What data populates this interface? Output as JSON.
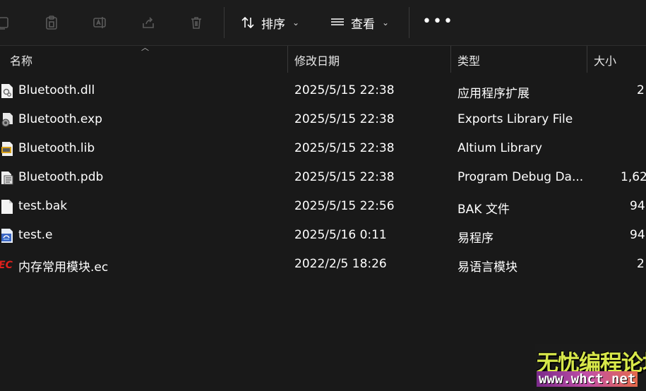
{
  "toolbar": {
    "sort_label": "排序",
    "view_label": "查看",
    "more_label": "•••"
  },
  "columns": {
    "name": "名称",
    "date": "修改日期",
    "type": "类型",
    "size": "大小"
  },
  "files": [
    {
      "name": "Bluetooth.dll",
      "date": "2025/5/15 22:38",
      "type": "应用程序扩展",
      "size": "2",
      "icon": "dll-file-icon"
    },
    {
      "name": "Bluetooth.exp",
      "date": "2025/5/15 22:38",
      "type": "Exports Library File",
      "size": "",
      "icon": "exp-file-icon"
    },
    {
      "name": "Bluetooth.lib",
      "date": "2025/5/15 22:38",
      "type": "Altium Library",
      "size": "",
      "icon": "lib-file-icon"
    },
    {
      "name": "Bluetooth.pdb",
      "date": "2025/5/15 22:38",
      "type": "Program Debug Da...",
      "size": "1,62",
      "icon": "pdb-file-icon"
    },
    {
      "name": "test.bak",
      "date": "2025/5/15 22:56",
      "type": "BAK 文件",
      "size": "94",
      "icon": "blank-file-icon"
    },
    {
      "name": "test.e",
      "date": "2025/5/16 0:11",
      "type": "易程序",
      "size": "94",
      "icon": "e-program-icon"
    },
    {
      "name": "内存常用模块.ec",
      "date": "2022/2/5 18:26",
      "type": "易语言模块",
      "size": "2",
      "icon": "ec-module-icon"
    }
  ],
  "watermark": {
    "title": "无忧编程论坛",
    "url": "www.whct.net"
  },
  "colors": {
    "background": "#191919",
    "toolbar": "#1c1c1c",
    "text": "#ffffff",
    "ec_icon": "#e0201c",
    "watermark_title": "#d8e84a"
  }
}
